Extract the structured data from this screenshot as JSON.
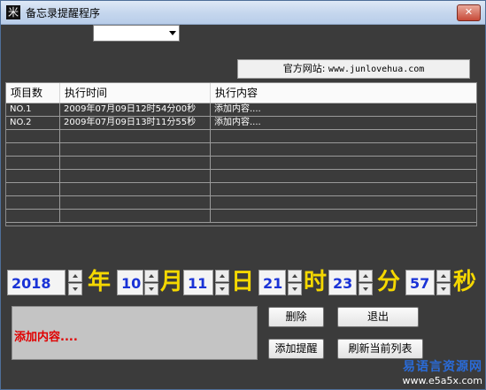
{
  "window": {
    "title": "备忘录提醒程序",
    "icon_glyph": "米"
  },
  "combo": {
    "value": ""
  },
  "site": {
    "label": "官方网站:",
    "url": "www.junlovehua.com"
  },
  "table": {
    "headers": [
      "项目数",
      "执行时间",
      "执行内容"
    ],
    "rows": [
      [
        "NO.1",
        "2009年07月09日12时54分00秒",
        "添加内容...."
      ],
      [
        "NO.2",
        "2009年07月09日13时11分55秒",
        "添加内容...."
      ],
      [
        "",
        "",
        ""
      ],
      [
        "",
        "",
        ""
      ],
      [
        "",
        "",
        ""
      ],
      [
        "",
        "",
        ""
      ],
      [
        "",
        "",
        ""
      ],
      [
        "",
        "",
        ""
      ],
      [
        "",
        "",
        ""
      ]
    ]
  },
  "datetime": {
    "year": "2018",
    "year_unit": "年",
    "month": "10",
    "month_unit": "月",
    "day": "11",
    "day_unit": "日",
    "hour": "21",
    "hour_unit": "时",
    "minute": "23",
    "minute_unit": "分",
    "second": "57",
    "second_unit": "秒"
  },
  "content": {
    "text": "添加内容...."
  },
  "buttons": {
    "delete": "删除",
    "exit": "退出",
    "add": "添加提醒",
    "refresh": "刷新当前列表"
  },
  "watermark": {
    "line1": "易语言资源网",
    "line2": "www.e5a5x.com"
  },
  "colors": {
    "accent_number": "#1a33d6",
    "unit": "#f5d800",
    "content_text": "#e00000",
    "background": "#3b3b3b"
  }
}
